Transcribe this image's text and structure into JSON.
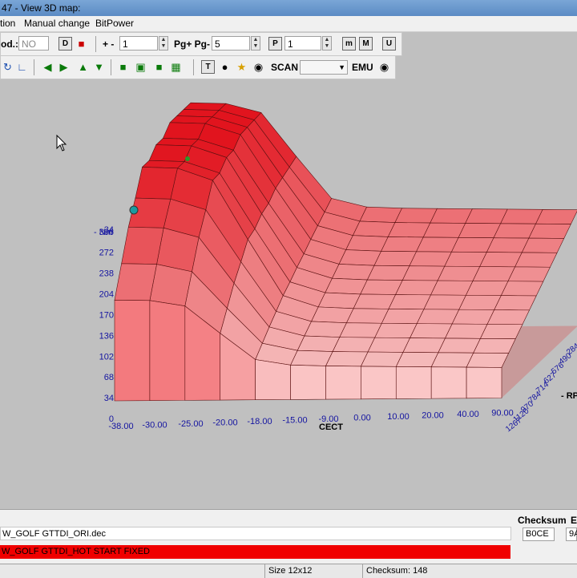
{
  "window": {
    "title": "47 - View 3D map:"
  },
  "menu": {
    "items": [
      "tion",
      "Manual change",
      "BitPower"
    ]
  },
  "toolbar1": {
    "mod_label": "od.:",
    "mod_value": "NO",
    "step_label": "+ -",
    "step_value": "1",
    "page_label": "Pg+ Pg-",
    "page_value": "5",
    "p_button": "P",
    "p_value": "1",
    "m_button": "m",
    "M_button": "M",
    "u_button": "U",
    "d_button": "D"
  },
  "toolbar2": {
    "scan_label": "SCAN",
    "scan_value": "",
    "emu_label": "EMU"
  },
  "chart_data": {
    "type": "surface3d",
    "z_axis": {
      "label": "- Nm",
      "ticks": [
        "0",
        "34",
        "68",
        "102",
        "136",
        "170",
        "204",
        "238",
        "272",
        "306",
        "34"
      ]
    },
    "x_axis": {
      "label": "CECT",
      "ticks": [
        "-38.00",
        "-30.00",
        "-25.00",
        "-20.00",
        "-18.00",
        "-15.00",
        "-9.00",
        "0.00",
        "10.00",
        "20.00",
        "40.00",
        "90.00"
      ]
    },
    "y_axis": {
      "label": "- RP",
      "ticks": [
        "1267",
        "1120",
        "970",
        "784",
        "714",
        "627",
        "576",
        "490",
        "284"
      ]
    },
    "color": "#e8202c"
  },
  "files": {
    "original": "W_GOLF GTTDI_ORI.dec",
    "modified": "W_GOLF GTTDI_HOT START FIXED"
  },
  "checksum_panel": {
    "header": "Checksum",
    "value": "B0CE",
    "header2": "E",
    "value2": "9A"
  },
  "status": {
    "size": "Size 12x12",
    "checksum": "Checksum: 148"
  },
  "colors": {
    "surface": "#e8202c",
    "file_highlight": "#f00000"
  }
}
